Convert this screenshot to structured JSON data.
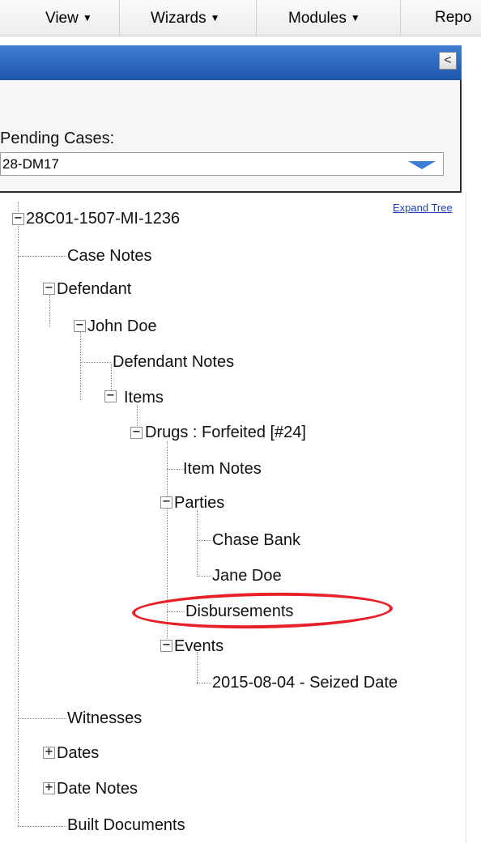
{
  "menu": {
    "items": [
      {
        "label": "View",
        "caret": "▼"
      },
      {
        "label": "Wizards",
        "caret": "▼"
      },
      {
        "label": "Modules",
        "caret": "▼"
      },
      {
        "label": "Repo",
        "caret": ""
      }
    ]
  },
  "header": {
    "collapse_glyph": "<"
  },
  "pending": {
    "label": "Pending Cases:",
    "selected": "28-DM17"
  },
  "tree": {
    "expand_link": "Expand Tree",
    "nodes": {
      "root": "28C01-1507-MI-1236",
      "case_notes": "Case Notes",
      "defendant": "Defendant",
      "john_doe": "John Doe",
      "defendant_notes": "Defendant Notes",
      "items": "Items",
      "drugs": "Drugs : Forfeited [#24]",
      "item_notes": "Item Notes",
      "parties": "Parties",
      "chase_bank": "Chase Bank",
      "jane_doe": "Jane Doe",
      "disbursements": "Disbursements",
      "events": "Events",
      "seized_date": "2015-08-04 - Seized Date",
      "witnesses": "Witnesses",
      "dates": "Dates",
      "date_notes": "Date Notes",
      "built_documents": "Built Documents"
    },
    "toggles": {
      "expanded": "−",
      "collapsed": "+"
    }
  },
  "colors": {
    "highlight": "#e8202a",
    "header_blue": "#1e55ad",
    "link": "#1f3fbf"
  }
}
